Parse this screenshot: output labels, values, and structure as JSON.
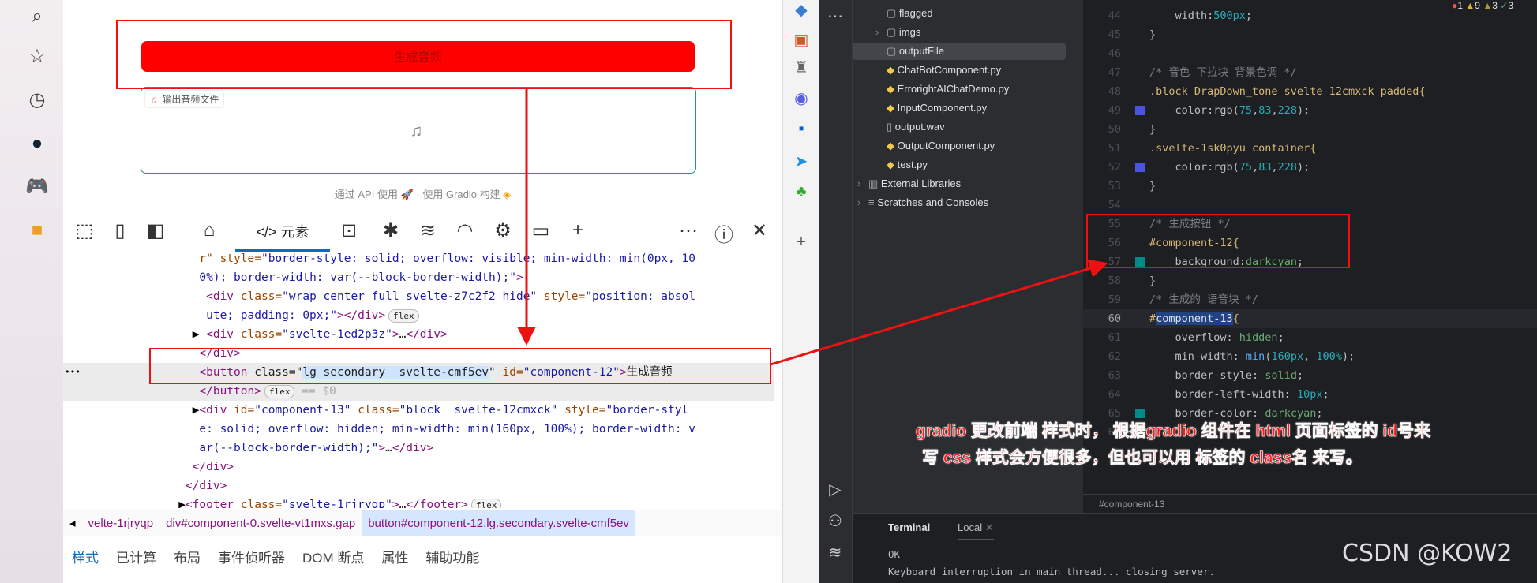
{
  "browser": {
    "left_sidebar_icons": [
      "search-icon",
      "star-icon",
      "history-icon",
      "copilot-icon",
      "games-icon",
      "toolbox-icon"
    ],
    "right_sidebar_icons": [
      "tag-icon",
      "briefcase-icon",
      "chess-icon",
      "copilot-icon",
      "outlook-icon",
      "send-icon",
      "tree-icon",
      "add-icon"
    ]
  },
  "gradio": {
    "generate_button": "生成音频",
    "audio_label": "输出音频文件",
    "audio_icon": "music-note-icon",
    "footer_api": "通过 API 使用",
    "footer_sep": "·",
    "footer_built": "使用 Gradio 构建",
    "button_color": "#ff0000",
    "audio_border": "#2a8f8f"
  },
  "devtools": {
    "toolbar": {
      "elements_tab": "</> 元素"
    },
    "code_lines": [
      {
        "indent": "      ",
        "tokens": [
          [
            "a",
            "r\" style="
          ],
          [
            "v",
            "\"border-style: solid; overflow: visible; min-width: min(0px, 10"
          ]
        ]
      },
      {
        "indent": "      ",
        "tokens": [
          [
            "v",
            "0%); border-width: var(--block-border-width);\""
          ],
          [
            "t",
            ">"
          ]
        ]
      },
      {
        "indent": "       ",
        "tokens": [
          [
            "t",
            "<div "
          ],
          [
            "a",
            "class="
          ],
          [
            "v",
            "\"wrap center full svelte-z7c2f2 hide\" "
          ],
          [
            "a",
            "style="
          ],
          [
            "v",
            "\"position: absol"
          ]
        ]
      },
      {
        "indent": "       ",
        "tokens": [
          [
            "v",
            "ute; padding: 0px;\""
          ],
          [
            "t",
            "></div>"
          ]
        ],
        "badge": "flex"
      },
      {
        "indent": "     ▶ ",
        "tokens": [
          [
            "t",
            "<div "
          ],
          [
            "a",
            "class="
          ],
          [
            "v",
            "\"svelte-1ed2p3z\""
          ],
          [
            "t",
            ">"
          ],
          [
            "x",
            "…"
          ],
          [
            "t",
            "</div>"
          ]
        ]
      },
      {
        "indent": "      ",
        "tokens": [
          [
            "t",
            "</div>"
          ]
        ]
      },
      {
        "indent": "      ",
        "selected": true,
        "tokens": [
          [
            "t",
            "<button "
          ],
          [
            "x",
            "class=\""
          ],
          [
            "h",
            "lg secondary  svelte-cmf5ev"
          ],
          [
            "x",
            "\" "
          ],
          [
            "a",
            "id="
          ],
          [
            "v",
            "\"component-12\""
          ],
          [
            "t",
            ">"
          ],
          [
            "x",
            "生成音频"
          ]
        ]
      },
      {
        "indent": "      ",
        "selected": true,
        "tokens": [
          [
            "t",
            "</button>"
          ]
        ],
        "badge": "flex",
        "suffix": " == $0"
      },
      {
        "indent": "     ▶",
        "tokens": [
          [
            "t",
            "<div "
          ],
          [
            "a",
            "id="
          ],
          [
            "v",
            "\"component-13\" "
          ],
          [
            "a",
            "class="
          ],
          [
            "v",
            "\"block  svelte-12cmxck\" "
          ],
          [
            "a",
            "style="
          ],
          [
            "v",
            "\"border-styl"
          ]
        ]
      },
      {
        "indent": "      ",
        "tokens": [
          [
            "v",
            "e: solid; overflow: hidden; min-width: min(160px, 100%); border-width: v"
          ]
        ]
      },
      {
        "indent": "      ",
        "tokens": [
          [
            "v",
            "ar(--block-border-width);\""
          ],
          [
            "t",
            ">"
          ],
          [
            "x",
            "…"
          ],
          [
            "t",
            "</div>"
          ]
        ]
      },
      {
        "indent": "     ",
        "tokens": [
          [
            "t",
            "</div>"
          ]
        ]
      },
      {
        "indent": "    ",
        "tokens": [
          [
            "t",
            "</div>"
          ]
        ]
      },
      {
        "indent": "   ▶",
        "tokens": [
          [
            "t",
            "<footer "
          ],
          [
            "a",
            "class="
          ],
          [
            "v",
            "\"svelte-1rjryqp\""
          ],
          [
            "t",
            ">"
          ],
          [
            "x",
            "…"
          ],
          [
            "t",
            "</footer>"
          ]
        ],
        "badge": "flex"
      }
    ],
    "breadcrumb": [
      "velte-1rjryqp",
      "div#component-0.svelte-vt1mxs.gap",
      "button#component-12.lg.secondary.svelte-cmf5ev"
    ],
    "bottom_tabs": [
      "样式",
      "已计算",
      "布局",
      "事件侦听器",
      "DOM 断点",
      "属性",
      "辅助功能"
    ],
    "row_menu": "•••"
  },
  "ide": {
    "tree": [
      {
        "label": "flagged",
        "icon": "folder-icon",
        "level": 2
      },
      {
        "label": "imgs",
        "icon": "folder-icon",
        "level": 2,
        "chevron": true
      },
      {
        "label": "outputFile",
        "icon": "folder-icon",
        "level": 2,
        "selected": true
      },
      {
        "label": "ChatBotComponent.py",
        "icon": "python-icon",
        "level": 2
      },
      {
        "label": "ErrorightAIChatDemo.py",
        "icon": "python-icon",
        "level": 2
      },
      {
        "label": "InputComponent.py",
        "icon": "python-icon",
        "level": 2
      },
      {
        "label": "output.wav",
        "icon": "unknown-file-icon",
        "level": 2
      },
      {
        "label": "OutputComponent.py",
        "icon": "python-icon",
        "level": 2
      },
      {
        "label": "test.py",
        "icon": "python-icon",
        "level": 2
      },
      {
        "label": "External Libraries",
        "icon": "library-icon",
        "level": 1,
        "chevron": true
      },
      {
        "label": "Scratches and Consoles",
        "icon": "scratches-icon",
        "level": 1,
        "chevron": true
      }
    ],
    "inspections": {
      "errors": "1",
      "warnings": "9",
      "weak_warnings": "3",
      "ok": "3"
    },
    "editor_lines": [
      {
        "n": "44",
        "tokens": [
          [
            "pr",
            "    width:"
          ],
          [
            "nm",
            "500px"
          ],
          [
            "pr",
            ";"
          ]
        ]
      },
      {
        "n": "45",
        "tokens": [
          [
            "pr",
            "}"
          ]
        ]
      },
      {
        "n": "46",
        "tokens": []
      },
      {
        "n": "47",
        "tokens": [
          [
            "cm",
            "/* 音色 下拉块 背景色调 */"
          ]
        ]
      },
      {
        "n": "48",
        "tokens": [
          [
            "sl",
            ".block DrapDown_tone svelte-12cmxck padded{"
          ]
        ]
      },
      {
        "n": "49",
        "swatch": "#4b53e4",
        "tokens": [
          [
            "pr",
            "    color:rgb("
          ],
          [
            "nm",
            "75"
          ],
          [
            "pr",
            ","
          ],
          [
            "nm",
            "83"
          ],
          [
            "pr",
            ","
          ],
          [
            "nm",
            "228"
          ],
          [
            "pr",
            ");"
          ]
        ]
      },
      {
        "n": "50",
        "tokens": [
          [
            "pr",
            "}"
          ]
        ]
      },
      {
        "n": "51",
        "tokens": [
          [
            "sl",
            ".svelte-1sk0pyu container{"
          ]
        ]
      },
      {
        "n": "52",
        "swatch": "#4b53e4",
        "tokens": [
          [
            "pr",
            "    color:rgb("
          ],
          [
            "nm",
            "75"
          ],
          [
            "pr",
            ","
          ],
          [
            "nm",
            "83"
          ],
          [
            "pr",
            ","
          ],
          [
            "nm",
            "228"
          ],
          [
            "pr",
            ");"
          ]
        ]
      },
      {
        "n": "53",
        "tokens": [
          [
            "pr",
            "}"
          ]
        ]
      },
      {
        "n": "54",
        "tokens": []
      },
      {
        "n": "55",
        "tokens": [
          [
            "cm",
            "/* 生成按钮 */"
          ]
        ]
      },
      {
        "n": "56",
        "tokens": [
          [
            "sl",
            "#component-12{"
          ]
        ]
      },
      {
        "n": "57",
        "swatch": "#008b8b",
        "tokens": [
          [
            "pr",
            "    background:"
          ],
          [
            "vl",
            "darkcyan"
          ],
          [
            "pr",
            ";"
          ]
        ]
      },
      {
        "n": "58",
        "tokens": [
          [
            "pr",
            "}"
          ]
        ]
      },
      {
        "n": "59",
        "tokens": [
          [
            "cm",
            "/* 生成的 语音块 */"
          ]
        ]
      },
      {
        "n": "60",
        "current": true,
        "tokens": [
          [
            "sl",
            "#"
          ],
          [
            "sh",
            "component-13"
          ],
          [
            "sl",
            "{"
          ]
        ]
      },
      {
        "n": "61",
        "tokens": [
          [
            "pr",
            "    overflow: "
          ],
          [
            "vl",
            "hidden"
          ],
          [
            "pr",
            ";"
          ]
        ]
      },
      {
        "n": "62",
        "tokens": [
          [
            "pr",
            "    min-width: "
          ],
          [
            "fn",
            "min"
          ],
          [
            "pr",
            "("
          ],
          [
            "nm",
            "160px"
          ],
          [
            "pr",
            ", "
          ],
          [
            "nm",
            "100%"
          ],
          [
            "pr",
            ");"
          ]
        ]
      },
      {
        "n": "63",
        "tokens": [
          [
            "pr",
            "    border-style: "
          ],
          [
            "vl",
            "solid"
          ],
          [
            "pr",
            ";"
          ]
        ]
      },
      {
        "n": "64",
        "tokens": [
          [
            "pr",
            "    border-left-width: "
          ],
          [
            "nm",
            "10px"
          ],
          [
            "pr",
            ";"
          ]
        ]
      },
      {
        "n": "65",
        "swatch": "#008b8b",
        "tokens": [
          [
            "pr",
            "    border-color: "
          ],
          [
            "vl",
            "darkcyan"
          ],
          [
            "pr",
            ";"
          ]
        ]
      },
      {
        "n": "66",
        "tokens": [
          [
            "pr",
            "}"
          ]
        ]
      }
    ],
    "breadcrumb": "#component-13",
    "terminal": {
      "tab_title": "Terminal",
      "tab_local": "Local",
      "lines": [
        "OK-----",
        "Keyboard interruption in main thread... closing server."
      ]
    }
  },
  "annotation": {
    "line1": "gradio 更改前端 样式时， 根据gradio 组件在 html 页面标签的 id号来",
    "line2": "写 css 样式会方便很多，但也可以用 标签的 class名 来写。",
    "color": "#ff1a1a"
  },
  "watermark": "CSDN @KOW2"
}
